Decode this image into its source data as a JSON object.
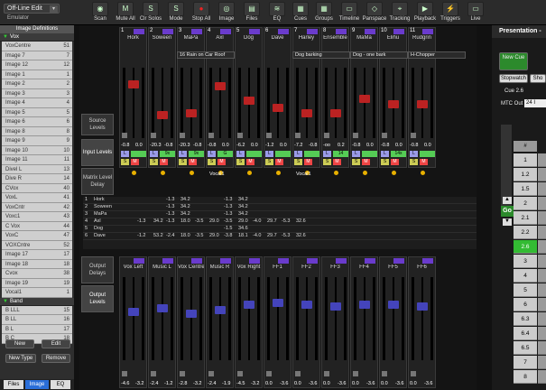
{
  "mode": {
    "label": "Off-Line Edit",
    "sub": "Emulator"
  },
  "toolbar": [
    {
      "label": "Scan",
      "icon": "radar-icon",
      "glyph": "◉"
    },
    {
      "label": "Mute All",
      "icon": "mute-icon",
      "glyph": "M"
    },
    {
      "label": "Clr Solos",
      "icon": "solo-icon",
      "glyph": "S"
    },
    {
      "label": "Mode",
      "icon": "mode-icon",
      "glyph": "S"
    },
    {
      "label": "Stop All",
      "icon": "stop-icon",
      "glyph": "●"
    },
    {
      "label": "Image",
      "icon": "image-icon",
      "glyph": "◎"
    },
    {
      "label": "Files",
      "icon": "files-icon",
      "glyph": "▤"
    },
    {
      "label": "EQ",
      "icon": "eq-icon",
      "glyph": "≋"
    },
    {
      "label": "Cues",
      "icon": "cues-icon",
      "glyph": "▦"
    },
    {
      "label": "Groups",
      "icon": "groups-icon",
      "glyph": "▦"
    },
    {
      "label": "Timeline",
      "icon": "timeline-icon",
      "glyph": "▭"
    },
    {
      "label": "Panspace",
      "icon": "panspace-icon",
      "glyph": "◇"
    },
    {
      "label": "Tracking",
      "icon": "tracking-icon",
      "glyph": "⌖"
    },
    {
      "label": "Playback",
      "icon": "playback-icon",
      "glyph": "▶"
    },
    {
      "label": "Triggers",
      "icon": "triggers-icon",
      "glyph": "⚡"
    },
    {
      "label": "Live",
      "icon": "live-icon",
      "glyph": "▭"
    }
  ],
  "left": {
    "header": "Image Definitions",
    "group1": "Vox",
    "items1": [
      [
        "VoxCentre",
        "51"
      ],
      [
        "Image 7",
        "7"
      ],
      [
        "Image 12",
        "12"
      ],
      [
        "Image 1",
        "1"
      ],
      [
        "Image 2",
        "2"
      ],
      [
        "Image 3",
        "3"
      ],
      [
        "Image 4",
        "4"
      ],
      [
        "Image 5",
        "5"
      ],
      [
        "Image 6",
        "6"
      ],
      [
        "Image 8",
        "8"
      ],
      [
        "Image 9",
        "9"
      ],
      [
        "Image 10",
        "10"
      ],
      [
        "Image 11",
        "11"
      ],
      [
        "Divel L",
        "13"
      ],
      [
        "Dive R",
        "14"
      ],
      [
        "CVox",
        "40"
      ],
      [
        "VoxL",
        "41"
      ],
      [
        "VoxCntr",
        "42"
      ],
      [
        "Voxc1",
        "43"
      ],
      [
        "C Vox",
        "44"
      ],
      [
        "VoxC",
        "47"
      ],
      [
        "VOXCntre",
        "52"
      ],
      [
        "Image 17",
        "17"
      ],
      [
        "Image 18",
        "18"
      ],
      [
        "Cvox",
        "38"
      ],
      [
        "Image 19",
        "19"
      ],
      [
        "Vocal1",
        "1"
      ]
    ],
    "group2": "Band",
    "items2": [
      [
        "B LLL",
        "15"
      ],
      [
        "B LL",
        "16"
      ],
      [
        "B L",
        "17"
      ],
      [
        "B C",
        "18"
      ]
    ],
    "new": "New",
    "edit": "Edit",
    "newtype": "New Type",
    "remove": "Remove"
  },
  "tabs": [
    "Files",
    "Image",
    "EQ"
  ],
  "sideButtons": [
    "Source Levels",
    "Input Levels",
    "Matrix Level Delay",
    "Output Delays",
    "Output Levels"
  ],
  "inputs": [
    {
      "n": "1",
      "name": "Hork",
      "cue": "",
      "vals": [
        "-0.8",
        "0.0"
      ],
      "tag": ""
    },
    {
      "n": "2",
      "name": "Soween",
      "cue": "16 Rain on Car Roof",
      "vals": [
        "-20.3",
        "-0.8"
      ],
      "tag": "9x"
    },
    {
      "n": "3",
      "name": "MaPa",
      "cue": "",
      "vals": [
        "-20.3",
        "-0.8"
      ],
      "tag": "9x"
    },
    {
      "n": "4",
      "name": "Axl",
      "cue": "",
      "vals": [
        "-0.8",
        "0.0"
      ],
      "tag": "G"
    },
    {
      "n": "5",
      "name": "Dog",
      "cue": "Dog barking",
      "vals": [
        "-6.2",
        "0.0"
      ],
      "tag": ""
    },
    {
      "n": "6",
      "name": "Dave",
      "cue": "",
      "vals": [
        "-1.2",
        "0.0"
      ],
      "tag": ""
    },
    {
      "n": "7",
      "name": "Harley",
      "cue": "Dog - one bark",
      "vals": [
        "-7.2",
        "-0.8"
      ],
      "tag": ""
    },
    {
      "n": "8",
      "name": "Ensemble",
      "cue": "",
      "vals": [
        "-oo",
        "0.2"
      ],
      "tag": "14"
    },
    {
      "n": "9",
      "name": "MaMa",
      "cue": "H-Chopper",
      "vals": [
        "-0.8",
        "0.0"
      ],
      "tag": ""
    },
    {
      "n": "10",
      "name": "Elihu",
      "cue": "",
      "vals": [
        "-0.8",
        "0.0"
      ],
      "tag": "14x"
    },
    {
      "n": "11",
      "name": "Rudgrin",
      "cue": "",
      "vals": [
        "-0.8",
        "0.0"
      ],
      "tag": ""
    }
  ],
  "vocalLabels": [
    "Vocal1",
    "Vocal1"
  ],
  "matrix": [
    {
      "n": "1",
      "name": "Hork",
      "cells": [
        "",
        "",
        "-1.3",
        "34.2",
        "",
        "",
        "-1.3",
        "34.2"
      ]
    },
    {
      "n": "2",
      "name": "Soween",
      "cells": [
        "",
        "",
        "-1.3",
        "34.2",
        "",
        "",
        "-1.3",
        "34.2"
      ]
    },
    {
      "n": "3",
      "name": "MaPa",
      "cells": [
        "",
        "",
        "-1.3",
        "34.2",
        "",
        "",
        "-1.3",
        "34.2"
      ]
    },
    {
      "n": "4",
      "name": "Axl",
      "cells": [
        "-1.3",
        "34.2",
        "-1.3",
        "18.0",
        "-3.5",
        "29.0",
        "-3.5",
        "29.0",
        "-4.0",
        "29.7",
        "-5.3",
        "32.6"
      ]
    },
    {
      "n": "5",
      "name": "Dog",
      "cells": [
        "",
        "",
        "",
        "",
        "",
        "",
        "-1.5",
        "34.6"
      ]
    },
    {
      "n": "6",
      "name": "Dave",
      "cells": [
        "-1.2",
        "53.2",
        "-2.4",
        "18.0",
        "-3.5",
        "29.0",
        "-3.8",
        "18.1",
        "-4.0",
        "29.7",
        "-5.3",
        "32.6"
      ]
    }
  ],
  "outputs": [
    {
      "name": "Vox Left",
      "vals": [
        "-4.6",
        "-3.2"
      ]
    },
    {
      "name": "Music L",
      "vals": [
        "-2.4",
        "-1.2"
      ]
    },
    {
      "name": "Vox Centre",
      "vals": [
        "-2.8",
        "-3.2"
      ]
    },
    {
      "name": "Music R",
      "vals": [
        "-2.4",
        "-1.9"
      ]
    },
    {
      "name": "Vox Right",
      "vals": [
        "-4.5",
        "-3.2"
      ]
    },
    {
      "name": "FF1",
      "vals": [
        "0.0",
        "-3.6"
      ]
    },
    {
      "name": "FF2",
      "vals": [
        "0.0",
        "-3.6"
      ]
    },
    {
      "name": "FF3",
      "vals": [
        "0.0",
        "-3.6"
      ]
    },
    {
      "name": "FF4",
      "vals": [
        "0.0",
        "-3.6"
      ]
    },
    {
      "name": "FF5",
      "vals": [
        "0.0",
        "-3.6"
      ]
    },
    {
      "name": "FF6",
      "vals": [
        "0.0",
        "-3.6"
      ]
    }
  ],
  "right": {
    "title": "Presentation -",
    "newcue": "New Cue",
    "stopwatch": "Stopwatch",
    "sho": "Sho",
    "cueLabel": "Cue 2.6",
    "mtc": "MTC Out",
    "mtcVal": "24 I",
    "go": "Go",
    "hash": "#",
    "cues": [
      "1",
      "1.2",
      "1.5",
      "2",
      "2.1",
      "2.2",
      "2.6",
      "3",
      "4",
      "5",
      "6",
      "6.3",
      "6.4",
      "6.5",
      "7",
      "8"
    ],
    "current": "2.6"
  }
}
